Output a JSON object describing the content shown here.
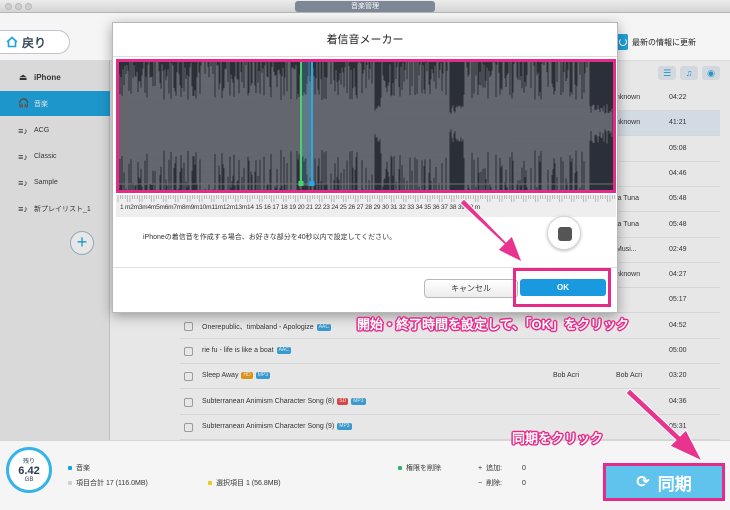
{
  "window": {
    "title": "音楽管理"
  },
  "topbar": {
    "back_label": "戻り",
    "update_label": "最新の情報に更新"
  },
  "sidebar": {
    "device": "iPhone",
    "items": [
      {
        "label": "音楽",
        "icon": "headphones-icon"
      },
      {
        "label": "ACG",
        "icon": "playlist-icon"
      },
      {
        "label": "Classic",
        "icon": "playlist-icon"
      },
      {
        "label": "Sample",
        "icon": "playlist-icon"
      },
      {
        "label": "新プレイリスト_1",
        "icon": "playlist-icon"
      }
    ]
  },
  "songs": [
    {
      "title": "",
      "artist": "",
      "album": "nknown",
      "time": "04:22"
    },
    {
      "title": "",
      "artist": "",
      "album": "nknown",
      "time": "41:21"
    },
    {
      "title": "",
      "artist": "",
      "album": "",
      "time": "05:08"
    },
    {
      "title": "",
      "artist": "",
      "album": "",
      "time": "04:46"
    },
    {
      "title": "",
      "artist": "",
      "album": "ja Tuna",
      "time": "05:48"
    },
    {
      "title": "",
      "artist": "",
      "album": "ja Tuna",
      "time": "05:48"
    },
    {
      "title": "",
      "artist": "",
      "album": "Musi...",
      "time": "02:49"
    },
    {
      "title": "",
      "artist": "",
      "album": "nknown",
      "time": "04:27"
    },
    {
      "title": "",
      "artist": "",
      "album": "",
      "time": "05:17"
    },
    {
      "title": "Onerepublic、timbaland - Apologize",
      "tags": [
        "AAC"
      ],
      "artist": "",
      "album": "",
      "time": "04:52"
    },
    {
      "title": "rie fu - life is like a boat",
      "tags": [
        "AAC"
      ],
      "artist": "",
      "album": "",
      "time": "05:00"
    },
    {
      "title": "Sleep Away",
      "tags": [
        "HD",
        "MP3"
      ],
      "artist": "Bob Acri",
      "album": "Bob Acri",
      "time": "03:20"
    },
    {
      "title": "Subterranean Animism Character Song (8)",
      "tags": [
        "SD",
        "MP3"
      ],
      "artist": "",
      "album": "",
      "time": "04:36"
    },
    {
      "title": "Subterranean Animism Character Song (9)",
      "tags": [
        "MP3"
      ],
      "artist": "",
      "album": "",
      "time": "05:31"
    }
  ],
  "status": {
    "storage_label": "残り",
    "storage_value": "6.42",
    "storage_unit": "GB",
    "music_label": "音楽",
    "total_label": "項目合計 17 (116.0MB)",
    "selected_label": "選択項目 1 (56.8MB)",
    "delete_perm_label": "権限を削除",
    "add_label": "追加:",
    "add_value": "0",
    "remove_label": "削除:",
    "remove_value": "0",
    "sync_label": "同期",
    "colors": {
      "music": "#1aa3e0",
      "selected": "#f5c518",
      "delete": "#2bb673"
    }
  },
  "modal": {
    "title": "着信音メーカー",
    "ruler_labels": "1 m2m3m4m5m6m7m8m9m10m11m12m13m14 15 16 17 18 19 20 21 22 23 24 25 26 27 28 29 30 31 32 33 34 35 36 37 38 39 40 m",
    "instruction": "iPhoneの着信音を作成する場合、お好きな部分を40秒以内で設定してください。",
    "cancel_label": "キャンセル",
    "ok_label": "OK"
  },
  "annotations": {
    "set_time": "開始・終了時間を設定して、「OK」をクリック",
    "sync_click": "同期をクリック"
  }
}
